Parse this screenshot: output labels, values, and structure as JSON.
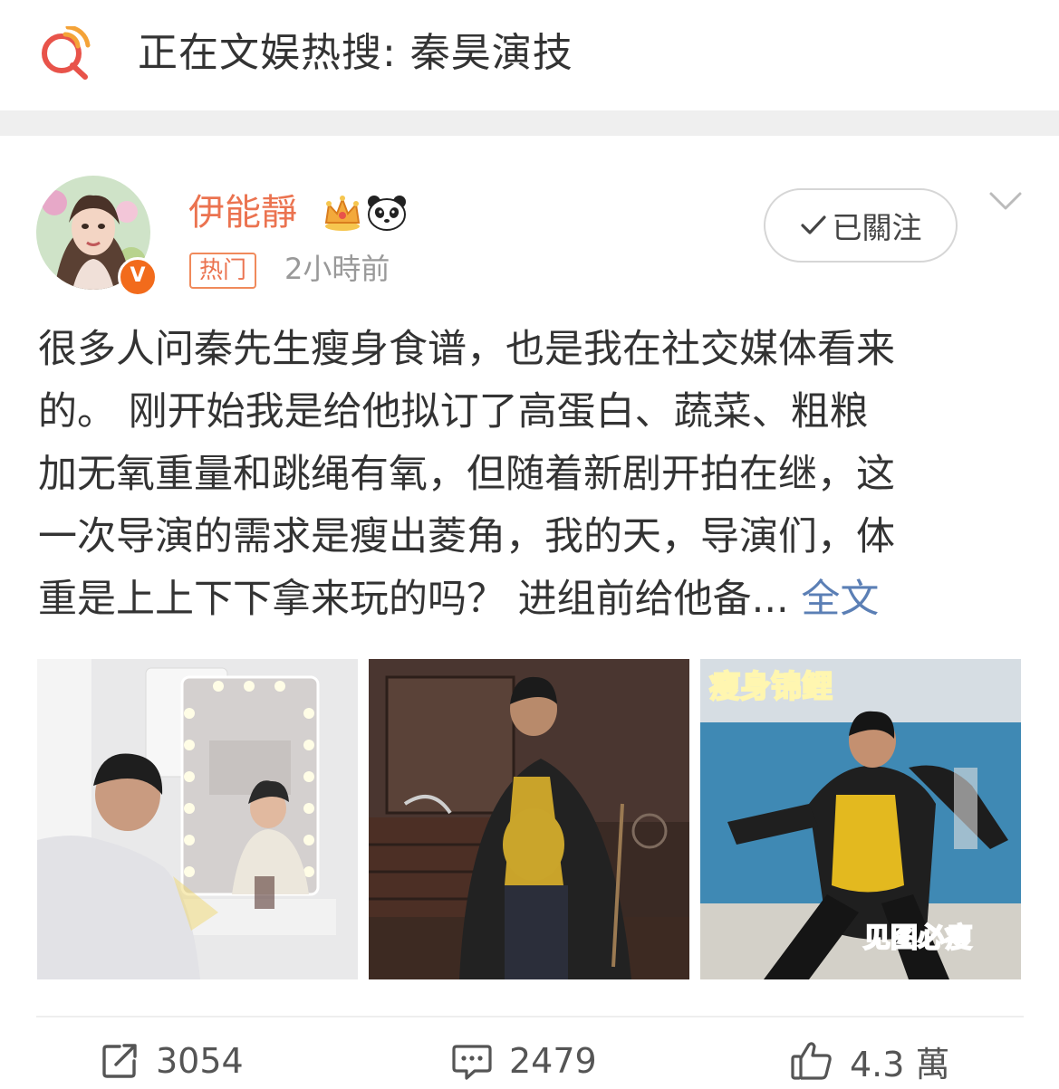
{
  "hot_search": {
    "icon": "hot-search-q-icon",
    "text": "正在文娱热搜: 秦昊演技"
  },
  "post": {
    "author": {
      "name": "伊能靜",
      "badges": [
        "crown-member-icon",
        "panda-icon"
      ],
      "verified_badge": "V",
      "avatar": "avatar-woman-with-flowers"
    },
    "tag": "热门",
    "time": "2小時前",
    "follow_button": {
      "icon": "check-icon",
      "label": "已關注"
    },
    "more_icon": "chevron-down-icon",
    "content_lines": [
      "很多人问秦先生瘦身食谱，也是我在社交媒体看来",
      "的。 刚开始我是给他拟订了高蛋白、蔬菜、粗粮",
      "加无氧重量和跳绳有氧，但随着新剧开拍在继，这",
      "一次导演的需求是瘦出菱角，我的天，导演们，体",
      "重是上上下下拿来玩的吗？ 进组前给他备..."
    ],
    "full_text_link": "全文",
    "images": [
      {
        "description": "dressing-room-mirror-photo"
      },
      {
        "description": "man-yellow-shirt-dancing-photo"
      },
      {
        "description": "variety-show-still-photo",
        "overlay_top": "瘦身锦鲤",
        "overlay_bottom": "见图必瘦"
      }
    ]
  },
  "actions": {
    "repost": {
      "icon": "repost-icon",
      "count": "3054"
    },
    "comment": {
      "icon": "comment-icon",
      "count": "2479"
    },
    "like": {
      "icon": "thumbs-up-icon",
      "count": "4.3 萬"
    }
  },
  "colors": {
    "username": "#eb7350",
    "link": "#5b7fb5",
    "hot_icon_red": "#e8534a",
    "hot_icon_orange": "#f4a338",
    "divider": "#efefef"
  }
}
